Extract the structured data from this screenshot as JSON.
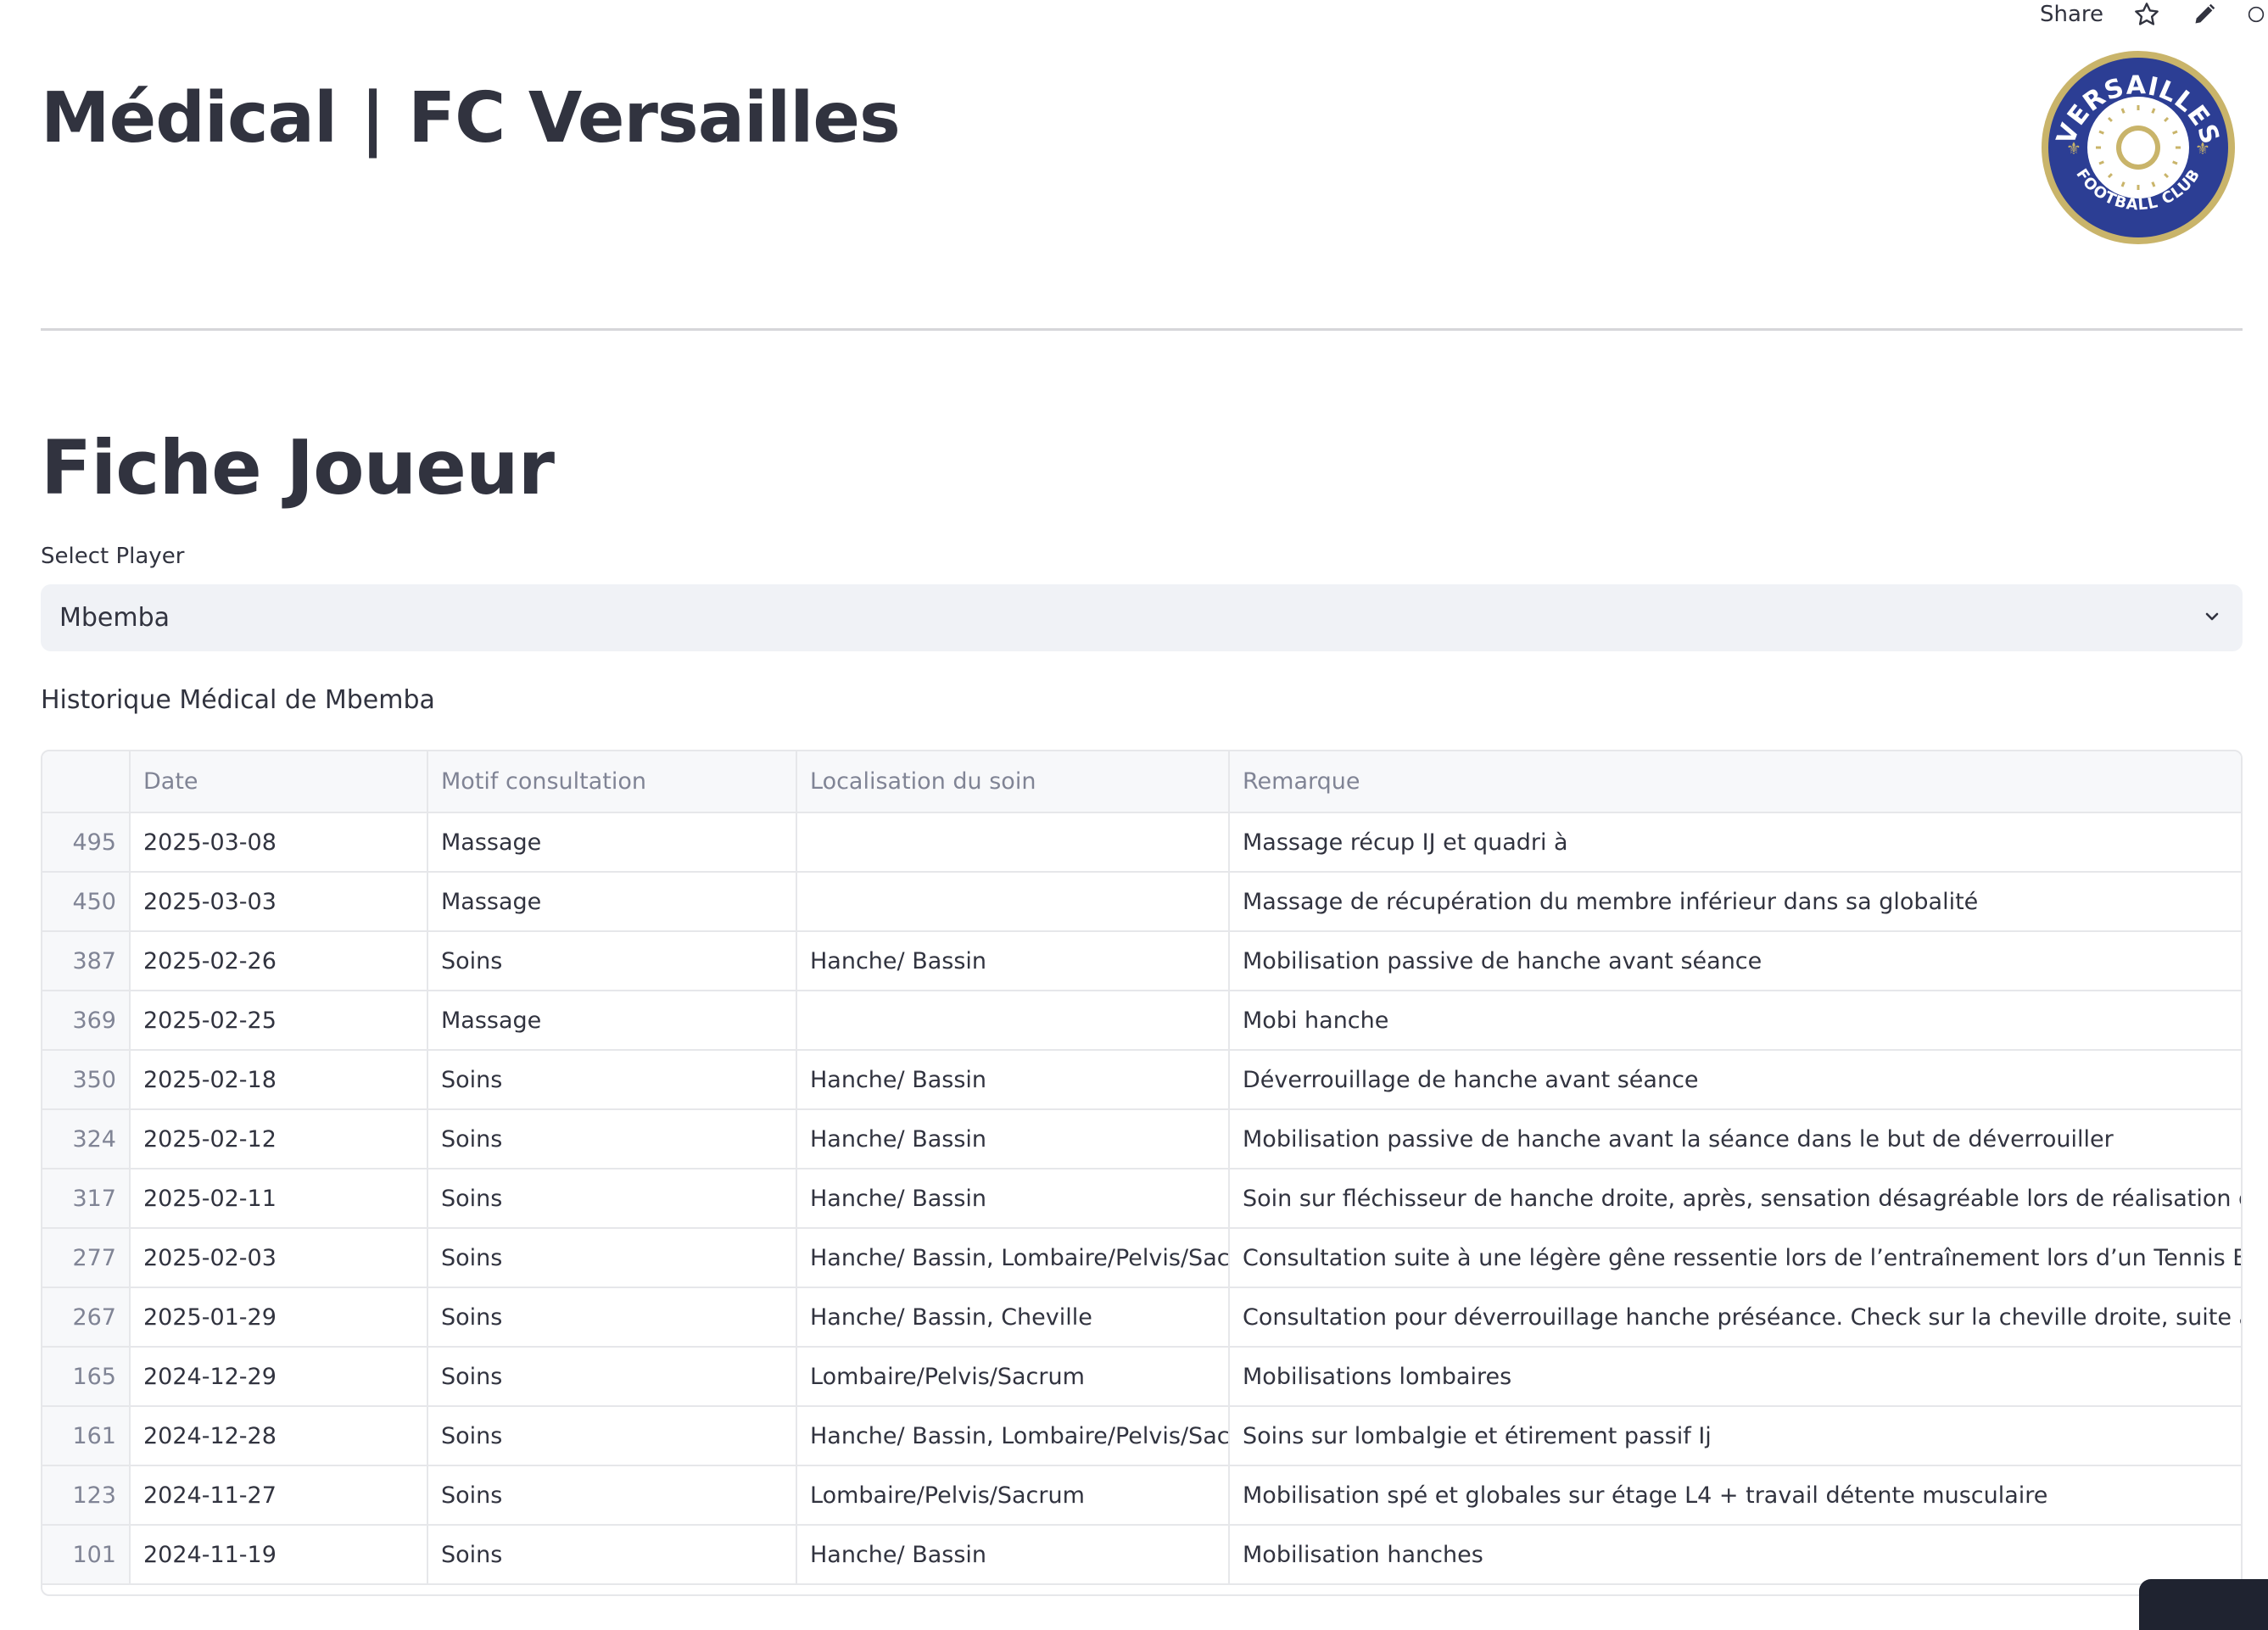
{
  "topbar": {
    "share_label": "Share",
    "icons": [
      "star-icon",
      "pencil-icon",
      "github-icon"
    ]
  },
  "header": {
    "title": "Médical | FC Versailles",
    "logo": {
      "text_top": "VERSAILLES",
      "text_bottom": "FOOTBALL CLUB",
      "colors": {
        "ring": "#c9b46a",
        "blue": "#2c3e94",
        "sun": "#c9b46a"
      }
    }
  },
  "section": {
    "title": "Fiche Joueur"
  },
  "player_select": {
    "label": "Select Player",
    "value": "Mbemba"
  },
  "history": {
    "caption": "Historique Médical de Mbemba",
    "columns": [
      "",
      "Date",
      "Motif consultation",
      "Localisation du soin",
      "Remarque"
    ],
    "rows": [
      [
        "495",
        "2025-03-08",
        "Massage",
        "",
        "Massage récup IJ et quadri à"
      ],
      [
        "450",
        "2025-03-03",
        "Massage",
        "",
        "Massage de récupération du membre inférieur dans sa globalité"
      ],
      [
        "387",
        "2025-02-26",
        "Soins",
        "Hanche/ Bassin",
        "Mobilisation passive de hanche avant séance"
      ],
      [
        "369",
        "2025-02-25",
        "Massage",
        "",
        "Mobi hanche"
      ],
      [
        "350",
        "2025-02-18",
        "Soins",
        "Hanche/ Bassin",
        "Déverrouillage de hanche avant séance"
      ],
      [
        "324",
        "2025-02-12",
        "Soins",
        "Hanche/ Bassin",
        "Mobilisation passive de hanche avant la séance dans le but de déverrouiller"
      ],
      [
        "317",
        "2025-02-11",
        "Soins",
        "Hanche/ Bassin",
        "Soin sur fléchisseur de hanche droite, après, sensation désagréable lors de réalisation des abdominau"
      ],
      [
        "277",
        "2025-02-03",
        "Soins",
        "Hanche/ Bassin, Lombaire/Pelvis/Sacrum",
        "Consultation suite à une légère gêne ressentie lors de l’entraînement lors d’un Tennis Ballon. Douleur"
      ],
      [
        "267",
        "2025-01-29",
        "Soins",
        "Hanche/ Bassin, Cheville",
        "Consultation pour déverrouillage hanche préséance. Check sur la cheville droite, suite à une petite tor"
      ],
      [
        "165",
        "2024-12-29",
        "Soins",
        "Lombaire/Pelvis/Sacrum",
        "Mobilisations lombaires"
      ],
      [
        "161",
        "2024-12-28",
        "Soins",
        "Hanche/ Bassin, Lombaire/Pelvis/Sacrum,",
        "Soins sur lombalgie et étirement passif Ij"
      ],
      [
        "123",
        "2024-11-27",
        "Soins",
        "Lombaire/Pelvis/Sacrum",
        "Mobilisation spé et globales sur étage L4 + travail détente musculaire"
      ],
      [
        "101",
        "2024-11-19",
        "Soins",
        "Hanche/ Bassin",
        "Mobilisation hanches"
      ]
    ]
  }
}
